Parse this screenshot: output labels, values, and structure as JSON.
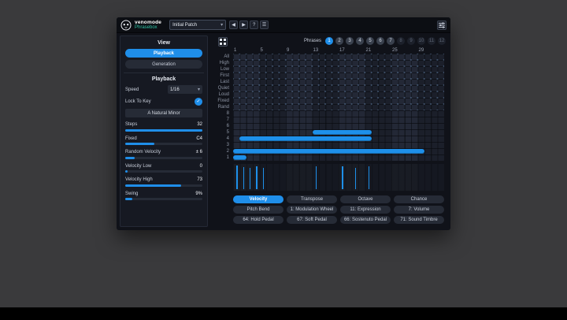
{
  "titlebar": {
    "brand": "venomode",
    "product": "Phrasebox",
    "preset": "Initial Patch",
    "buttons": [
      {
        "name": "prev-preset",
        "glyph": "◀"
      },
      {
        "name": "next-preset",
        "glyph": "▶"
      },
      {
        "name": "help",
        "glyph": "?"
      },
      {
        "name": "preset-menu",
        "glyph": "☰"
      }
    ]
  },
  "sidebar": {
    "view_title": "View",
    "view_buttons": [
      {
        "label": "Playback",
        "active": true
      },
      {
        "label": "Generation",
        "active": false
      }
    ],
    "section_title": "Playback",
    "speed": {
      "label": "Speed",
      "value": "1/16"
    },
    "lock_to_key": {
      "label": "Lock To Key",
      "checked": true
    },
    "key_button": "A Natural Minor",
    "sliders": [
      {
        "label": "Steps",
        "value": "32",
        "fill": 100
      },
      {
        "label": "Fixed",
        "value": "C4",
        "fill": 38
      },
      {
        "label": "Random Velocity",
        "value": "± 6",
        "fill": 12
      },
      {
        "label": "Velocity Low",
        "value": "0",
        "fill": 3
      },
      {
        "label": "Velocity High",
        "value": "73",
        "fill": 72
      },
      {
        "label": "Swing",
        "value": "9%",
        "fill": 9
      }
    ]
  },
  "phrases": {
    "label": "Phrases",
    "items": [
      {
        "n": "1",
        "state": "active"
      },
      {
        "n": "2",
        "state": "normal"
      },
      {
        "n": "3",
        "state": "normal"
      },
      {
        "n": "4",
        "state": "normal"
      },
      {
        "n": "5",
        "state": "normal"
      },
      {
        "n": "6",
        "state": "normal"
      },
      {
        "n": "7",
        "state": "normal"
      },
      {
        "n": "8",
        "state": "dim"
      },
      {
        "n": "9",
        "state": "dim"
      },
      {
        "n": "10",
        "state": "dim"
      },
      {
        "n": "11",
        "state": "dim"
      },
      {
        "n": "12",
        "state": "dim"
      }
    ]
  },
  "grid": {
    "columns": 32,
    "column_numbers": [
      "1",
      "5",
      "9",
      "13",
      "17",
      "21",
      "25",
      "29"
    ],
    "row_labels": [
      "All",
      "High",
      "Low",
      "First",
      "Last",
      "Quiet",
      "Loud",
      "Fixed",
      "Rand",
      "8",
      "7",
      "6",
      "5",
      "4",
      "3",
      "2",
      "1"
    ],
    "notes": [
      {
        "row": "5",
        "start": 13,
        "steps": 9
      },
      {
        "row": "4",
        "start": 2,
        "steps": 20
      },
      {
        "row": "2",
        "start": 1,
        "steps": 29
      },
      {
        "row": "1",
        "start": 1,
        "steps": 2
      }
    ],
    "velocity_stems": [
      {
        "step": 1,
        "level": 88
      },
      {
        "step": 2,
        "level": 82
      },
      {
        "step": 3,
        "level": 78
      },
      {
        "step": 4,
        "level": 84
      },
      {
        "step": 5,
        "level": 80
      },
      {
        "step": 13,
        "level": 84
      },
      {
        "step": 17,
        "level": 86
      },
      {
        "step": 19,
        "level": 80
      },
      {
        "step": 21,
        "level": 84
      }
    ]
  },
  "tabs": {
    "rows": [
      [
        {
          "label": "Velocity",
          "active": true
        },
        {
          "label": "Transpose",
          "active": false
        },
        {
          "label": "Octave",
          "active": false
        },
        {
          "label": "Chance",
          "active": false
        }
      ],
      [
        {
          "label": "Pitch Bend",
          "active": false
        },
        {
          "label": "1: Modulation Wheel",
          "active": false
        },
        {
          "label": "11: Expression",
          "active": false
        },
        {
          "label": "7: Volume",
          "active": false
        }
      ],
      [
        {
          "label": "64: Hold Pedal",
          "active": false
        },
        {
          "label": "67: Soft Pedal",
          "active": false
        },
        {
          "label": "66: Sostenuto Pedal",
          "active": false
        },
        {
          "label": "71: Sound Timbre",
          "active": false
        }
      ]
    ]
  },
  "colors": {
    "accent": "#1f8ee9",
    "note_blue": "#1e90ea",
    "brand_teal": "#2ec4a5",
    "desktop": "#3a3a3c"
  }
}
